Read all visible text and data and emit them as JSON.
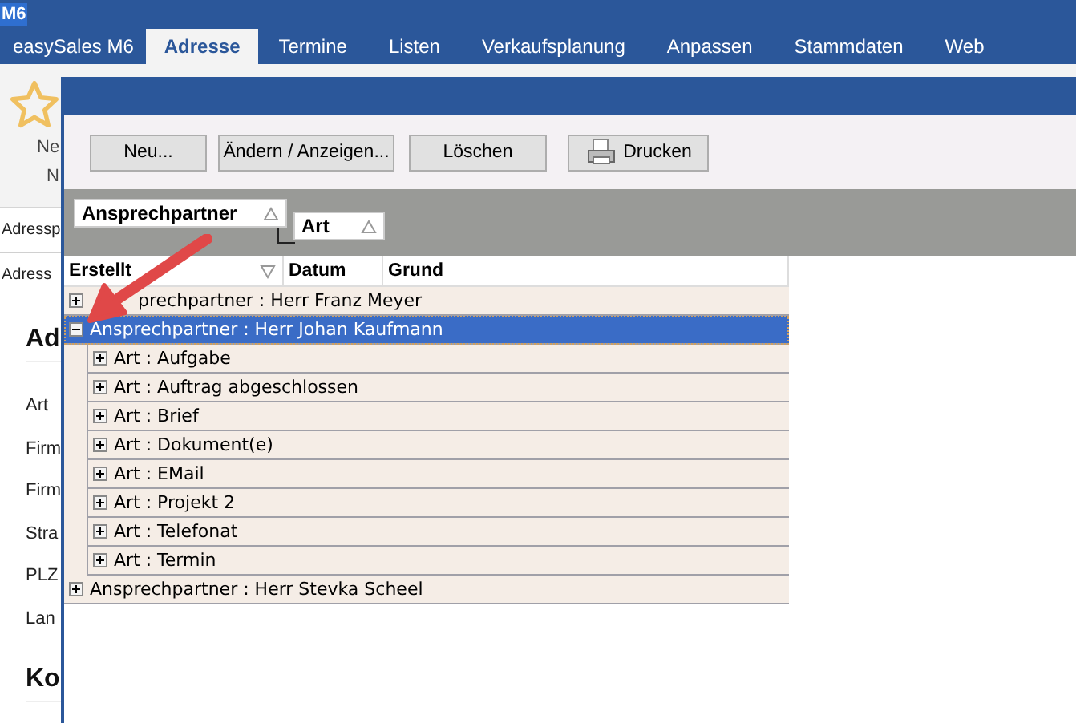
{
  "app": {
    "title": "M6",
    "tabs": [
      {
        "label": "easySales M6",
        "selected": false
      },
      {
        "label": "Adresse",
        "selected": true
      },
      {
        "label": "Termine",
        "selected": false
      },
      {
        "label": "Listen",
        "selected": false
      },
      {
        "label": "Verkaufsplanung",
        "selected": false
      },
      {
        "label": "Anpassen",
        "selected": false
      },
      {
        "label": "Stammdaten",
        "selected": false
      },
      {
        "label": "Web",
        "selected": false
      }
    ],
    "ribbon": [
      "Ne",
      "N"
    ],
    "panel_tabs": [
      "Adressp",
      "Adress"
    ],
    "fields": [
      {
        "kind": "heading",
        "text": "Ad"
      },
      {
        "kind": "label",
        "text": "Art"
      },
      {
        "kind": "label",
        "text": "Firm"
      },
      {
        "kind": "label",
        "text": "Firm"
      },
      {
        "kind": "label",
        "text": "Stra"
      },
      {
        "kind": "label",
        "text": "PLZ"
      },
      {
        "kind": "label",
        "text": "Lan"
      },
      {
        "kind": "heading",
        "text": "Ko"
      }
    ]
  },
  "dialog": {
    "buttons": [
      {
        "label": "Neu...",
        "kind": "plain"
      },
      {
        "label": "Ändern / Anzeigen...",
        "kind": "plain"
      },
      {
        "label": "Löschen",
        "kind": "plain"
      },
      {
        "label": "Drucken",
        "kind": "print"
      }
    ],
    "group_by": [
      "Ansprechpartner",
      "Art"
    ],
    "columns": [
      {
        "label": "Erstellt",
        "sorted": true
      },
      {
        "label": "Datum",
        "sorted": false
      },
      {
        "label": "Grund",
        "sorted": false
      }
    ],
    "tree": [
      {
        "label": "prechpartner : Herr Franz Meyer",
        "selected": false,
        "expanded": false
      },
      {
        "label": "Ansprechpartner : Herr Johan Kaufmann",
        "selected": true,
        "expanded": true,
        "children": [
          {
            "label": "Art : Aufgabe",
            "selected": false,
            "expanded": false
          },
          {
            "label": "Art : Auftrag abgeschlossen",
            "selected": false,
            "expanded": false
          },
          {
            "label": "Art : Brief",
            "selected": false,
            "expanded": false
          },
          {
            "label": "Art : Dokument(e)",
            "selected": false,
            "expanded": false
          },
          {
            "label": "Art : EMail",
            "selected": false,
            "expanded": false
          },
          {
            "label": "Art : Projekt 2",
            "selected": false,
            "expanded": false
          },
          {
            "label": "Art : Telefonat",
            "selected": false,
            "expanded": false
          },
          {
            "label": "Art : Termin",
            "selected": false,
            "expanded": false
          }
        ]
      },
      {
        "label": "Ansprechpartner : Herr Stevka Scheel",
        "selected": false,
        "expanded": false
      }
    ]
  }
}
